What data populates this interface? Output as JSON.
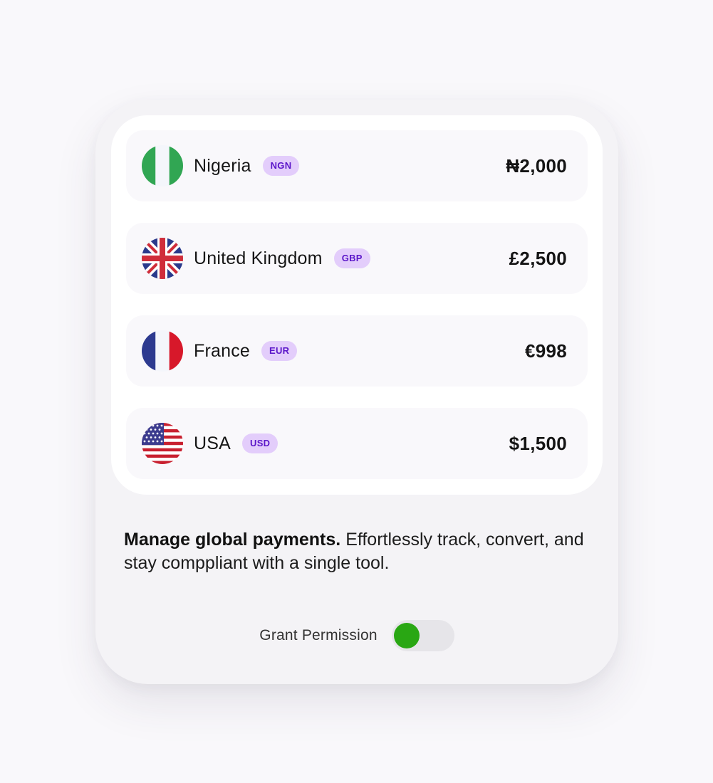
{
  "currencies": [
    {
      "country": "Nigeria",
      "code": "NGN",
      "amount": "₦2,000",
      "flag_icon": "nigeria-flag-icon"
    },
    {
      "country": "United Kingdom",
      "code": "GBP",
      "amount": "£2,500",
      "flag_icon": "uk-flag-icon"
    },
    {
      "country": "France",
      "code": "EUR",
      "amount": "€998",
      "flag_icon": "france-flag-icon"
    },
    {
      "country": "USA",
      "code": "USD",
      "amount": "$1,500",
      "flag_icon": "usa-flag-icon"
    }
  ],
  "description": {
    "bold": "Manage global payments.",
    "text": " Effortlessly track, convert, and stay comppliant with a single tool."
  },
  "permission": {
    "label": "Grant Permission",
    "enabled": true
  },
  "colors": {
    "badge_bg": "#e3cdfb",
    "badge_text": "#5b16c9",
    "toggle_on": "#29a713",
    "page_bg": "#f9f8fb"
  }
}
